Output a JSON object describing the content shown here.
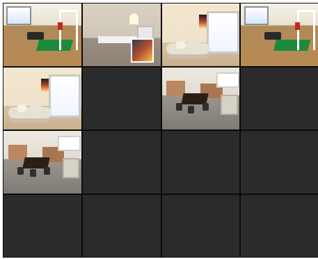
{
  "view": {
    "layout": "4x4",
    "tiles": [
      {
        "kind": "gym"
      },
      {
        "kind": "office"
      },
      {
        "kind": "room"
      },
      {
        "kind": "gym"
      },
      {
        "kind": "room"
      },
      {
        "kind": "empty"
      },
      {
        "kind": "desks"
      },
      {
        "kind": "empty"
      },
      {
        "kind": "desks"
      },
      {
        "kind": "empty"
      },
      {
        "kind": "empty"
      },
      {
        "kind": "empty"
      },
      {
        "kind": "empty"
      },
      {
        "kind": "empty"
      },
      {
        "kind": "empty"
      },
      {
        "kind": "empty"
      }
    ],
    "selected_index": 1,
    "colors": {
      "background": "#0b0b0b",
      "empty_tile": "#2b2b2b",
      "selection": "#ffffff"
    }
  }
}
